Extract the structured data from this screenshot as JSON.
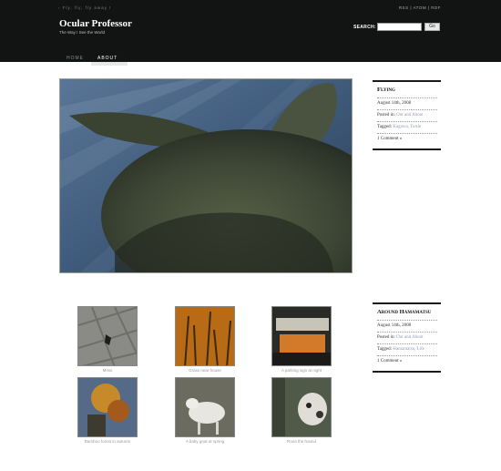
{
  "header": {
    "nav_prev": "‹ Fly, fly, fly away !",
    "rss_links": "RSS | ATOM | RDF",
    "site_title": "Ocular Professor",
    "site_tagline": "The Way I See the World",
    "search_label": "SEARCH:",
    "search_value": "",
    "search_button": "Go"
  },
  "nav": {
    "items": [
      {
        "label": "HOME"
      },
      {
        "label": "ABOUT"
      }
    ]
  },
  "posts": [
    {
      "title": "Flying",
      "date": "August 14th, 2008",
      "posted_label": "Posted in:",
      "posted_value": "Out and About",
      "tagged_label": "Tagged:",
      "tagged_value": "Kagawa, Turtle",
      "comments": "1 Comment »"
    },
    {
      "title": "Around Hamamatsu",
      "date": "August 14th, 2008",
      "posted_label": "Posted in:",
      "posted_value": "Out and About",
      "tagged_label": "Tagged:",
      "tagged_value": "Hamamatsu, Life",
      "comments": "1 Comment »"
    }
  ],
  "gallery": [
    {
      "caption": "Moss",
      "icon": "photo-bird-on-tiles"
    },
    {
      "caption": "Grass near house",
      "icon": "photo-orange-grass"
    },
    {
      "caption": "A parking sign at night",
      "icon": "photo-night-sign"
    },
    {
      "caption": "Bamboo forest in autumn",
      "icon": "photo-autumn-leaves"
    },
    {
      "caption": "A baby goat at spring",
      "icon": "photo-goat"
    },
    {
      "caption": "Rona the hound",
      "icon": "photo-dog"
    }
  ],
  "colors": {
    "header_bg": "#111412",
    "link": "#8fa0b4",
    "caption": "#999999"
  }
}
